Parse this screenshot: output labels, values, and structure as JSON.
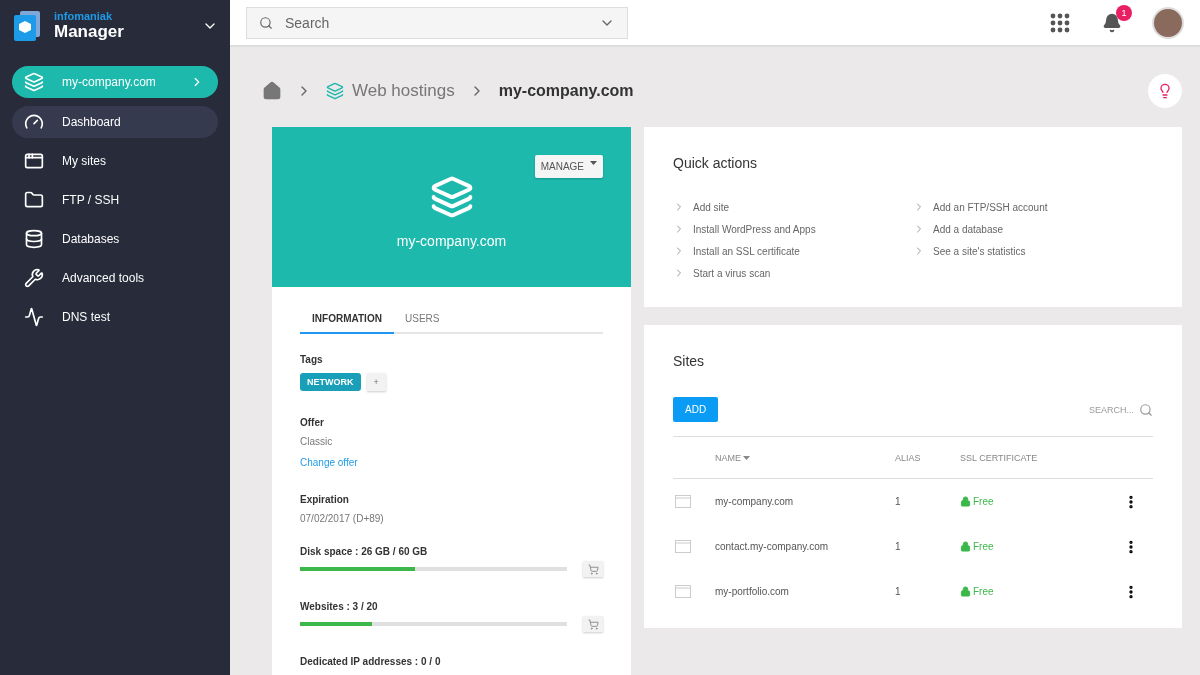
{
  "brand": {
    "company": "infomaniak",
    "product": "Manager"
  },
  "sidebar": {
    "site": {
      "label": "my-company.com"
    },
    "items": [
      {
        "label": "Dashboard",
        "selected": true
      },
      {
        "label": "My sites",
        "selected": false
      },
      {
        "label": "FTP / SSH",
        "selected": false
      },
      {
        "label": "Databases",
        "selected": false
      },
      {
        "label": "Advanced tools",
        "selected": false
      },
      {
        "label": "DNS test",
        "selected": false
      }
    ]
  },
  "topbar": {
    "search": {
      "placeholder": "Search"
    },
    "notifications": "1"
  },
  "breadcrumb": {
    "section": "Web hostings",
    "current": "my-company.com"
  },
  "hosting": {
    "name": "my-company.com",
    "manage": "MANAGE",
    "tabs": [
      {
        "label": "INFORMATION",
        "selected": true
      },
      {
        "label": "USERS",
        "selected": false
      }
    ],
    "tags_label": "Tags",
    "tags": [
      {
        "label": "NETWORK",
        "color": "#1a9fb8"
      }
    ],
    "add_tag": "+",
    "offer_label": "Offer",
    "offer": "Classic",
    "change_offer": "Change offer",
    "expiration_label": "Expiration",
    "expiration": "07/02/2017 (D+89)",
    "quotas": [
      {
        "label": "Disk space : 26 GB / 60 GB",
        "level": 0.43
      },
      {
        "label": "Websites : 3 / 20",
        "level": 0.27
      }
    ],
    "dedicated_ip": "Dedicated IP addresses : 0 / 0"
  },
  "quick_actions": {
    "title": "Quick actions",
    "columns": [
      [
        "Add site",
        "Install WordPress and Apps",
        "Install an SSL certificate",
        "Start a virus scan"
      ],
      [
        "Add an FTP/SSH account",
        "Add a database",
        "See a site's statistics"
      ]
    ]
  },
  "sites": {
    "title": "Sites",
    "add": "ADD",
    "search_placeholder": "SEARCH...",
    "columns": [
      "NAME",
      "ALIAS",
      "SSL CERTIFICATE"
    ],
    "rows": [
      {
        "name": "my-company.com",
        "alias": "1",
        "ssl": "Free"
      },
      {
        "name": "contact.my-company.com",
        "alias": "1",
        "ssl": "Free"
      },
      {
        "name": "my-portfolio.com",
        "alias": "1",
        "ssl": "Free"
      }
    ]
  }
}
